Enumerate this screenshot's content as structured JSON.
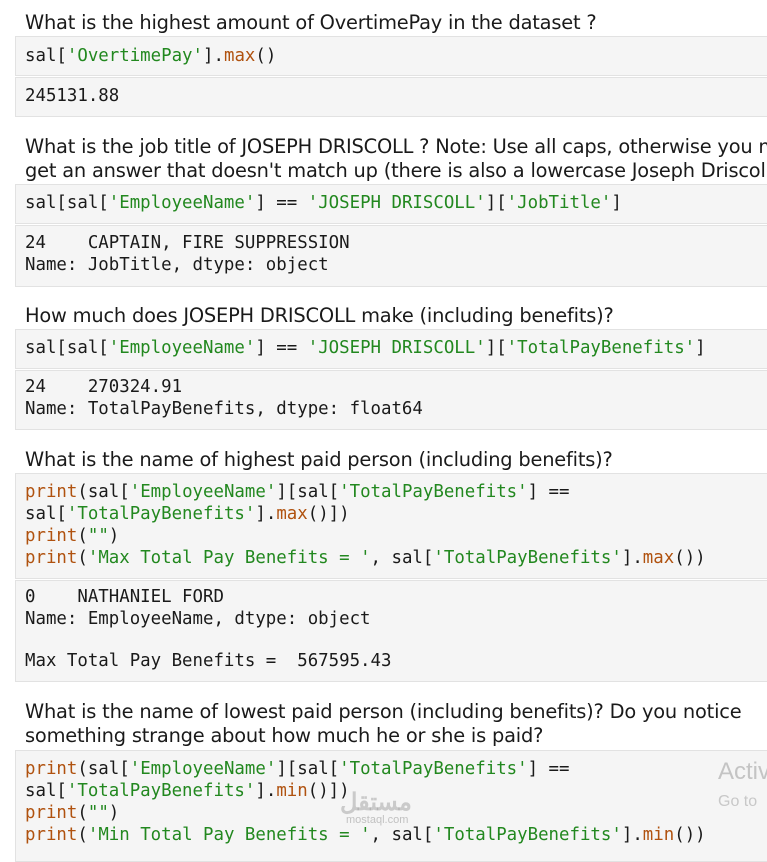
{
  "q1": {
    "text": "What is the highest amount of OvertimePay in the dataset ?",
    "code": [
      "sal['OvertimePay'].max()"
    ],
    "output": [
      "245131.88"
    ]
  },
  "q2": {
    "text": [
      "What is the job title of JOSEPH DRISCOLL ? Note: Use all caps, otherwise you m",
      "get an answer that doesn't match up (there is also a lowercase Joseph Driscoll)"
    ],
    "code": [
      "sal[sal['EmployeeName'] == 'JOSEPH DRISCOLL']['JobTitle']"
    ],
    "output": [
      "24    CAPTAIN, FIRE SUPPRESSION",
      "Name: JobTitle, dtype: object"
    ]
  },
  "q3": {
    "text": "How much does JOSEPH DRISCOLL make (including benefits)?",
    "code": [
      "sal[sal['EmployeeName'] == 'JOSEPH DRISCOLL']['TotalPayBenefits']"
    ],
    "output": [
      "24    270324.91",
      "Name: TotalPayBenefits, dtype: float64"
    ]
  },
  "q4": {
    "text": "What is the name of highest paid person (including benefits)?",
    "code": [
      "print(sal['EmployeeName'][sal['TotalPayBenefits'] ==",
      "sal['TotalPayBenefits'].max()])",
      "print(\"\")",
      "print('Max Total Pay Benefits = ', sal['TotalPayBenefits'].max())"
    ],
    "output": [
      "0    NATHANIEL FORD",
      "Name: EmployeeName, dtype: object",
      "",
      "Max Total Pay Benefits =  567595.43"
    ]
  },
  "q5": {
    "text": [
      "What is the name of lowest paid person (including benefits)? Do you notice",
      "something strange about how much he or she is paid?"
    ],
    "code": [
      "print(sal['EmployeeName'][sal['TotalPayBenefits'] ==",
      "sal['TotalPayBenefits'].min()])",
      "print(\"\")",
      "print('Min Total Pay Benefits = ', sal['TotalPayBenefits'].min())"
    ]
  },
  "watermark": {
    "activate_line1": "Activ",
    "activate_line2": "Go to",
    "logo_text": "مستقل",
    "logo_url": "mostaql.com"
  }
}
